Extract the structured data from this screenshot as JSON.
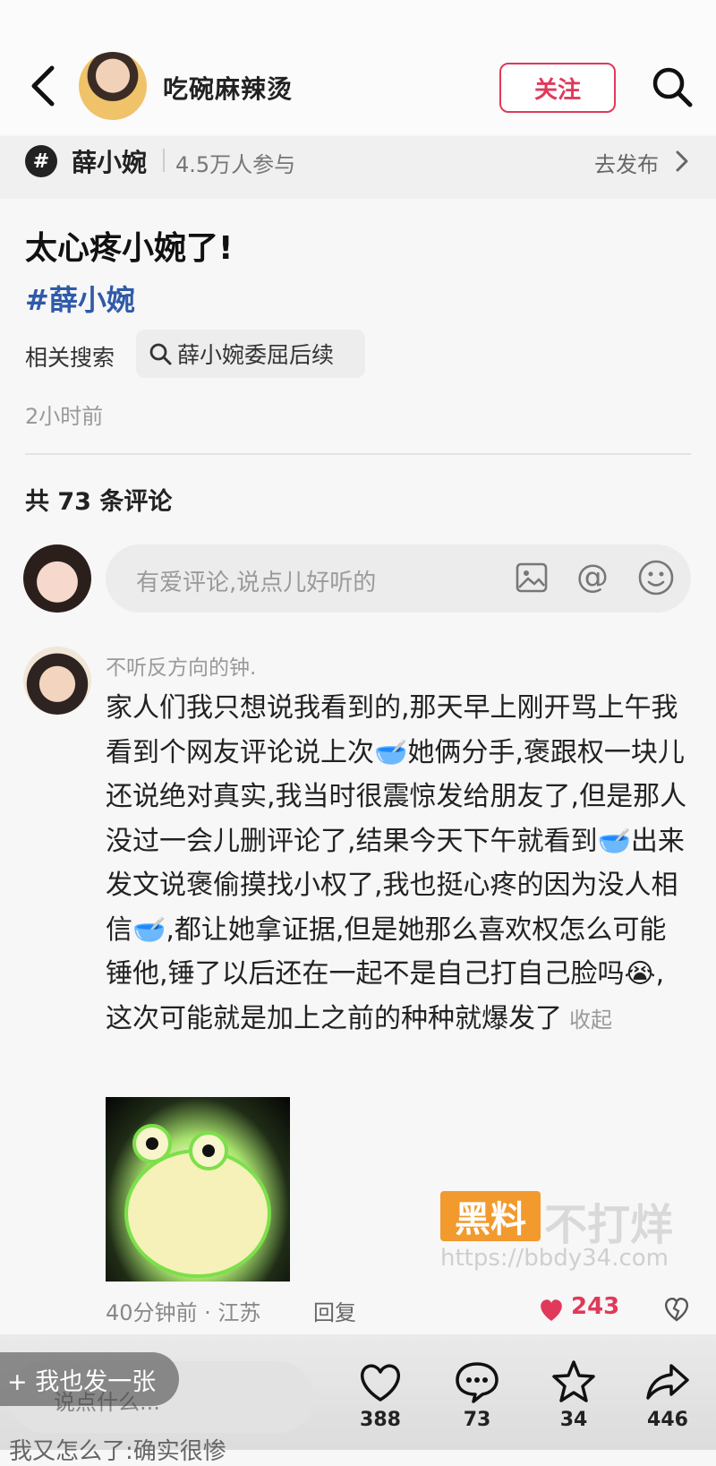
{
  "header": {
    "author_name": "吃碗麻辣烫",
    "follow_label": "关注"
  },
  "topic": {
    "name": "薛小婉",
    "participants": "4.5万人参与",
    "go_post_label": "去发布"
  },
  "post": {
    "title": "太心疼小婉了!",
    "hashtag": "#薛小婉",
    "related_label": "相关搜索",
    "related_query": "薛小婉委屈后续",
    "time": "2小时前"
  },
  "comments": {
    "count_label": "共 73 条评论",
    "input_placeholder": "有爱评论,说点儿好听的",
    "items": [
      {
        "user": "不听反方向的钟.",
        "text": "家人们我只想说我看到的,那天早上刚开骂上午我看到个网友评论说上次🥣她俩分手,褒跟权一块儿还说绝对真实,我当时很震惊发给朋友了,但是那人没过一会儿删评论了,结果今天下午就看到🥣出来发文说褒偷摸找小权了,我也挺心疼的因为没人相信🥣,都让她拿证据,但是她那么喜欢权怎么可能锤他,锤了以后还在一起不是自己打自己脸吗😭,这次可能就是加上之前的种种就爆发了",
        "collapse_label": "收起",
        "meta": "40分钟前 · 江苏",
        "reply_label": "回复",
        "likes": "243"
      }
    ]
  },
  "watermark": {
    "badge": "黑料",
    "text": "不打烊",
    "url": "https://bbdy34.com"
  },
  "bottom": {
    "post_too_label": "+ 我也发一张",
    "input_placeholder": "说点什么...",
    "likes": "388",
    "comments": "73",
    "favorites": "34",
    "shares": "446",
    "peek_text": "我又怎么了:确实很惨"
  },
  "colors": {
    "accent": "#e0395a",
    "tag_blue": "#2f5aa8",
    "watermark_orange": "#f29a2e"
  }
}
